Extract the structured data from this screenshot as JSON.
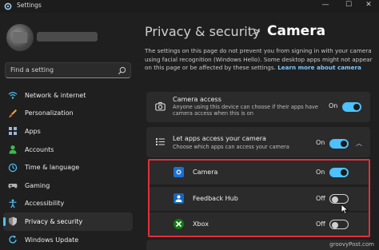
{
  "window": {
    "title": "Settings",
    "minimize": "—",
    "maximize": "☐",
    "close": "✕"
  },
  "sidebar": {
    "search_placeholder": "Find a setting",
    "items": [
      {
        "label": "Network & internet",
        "icon": "wifi-icon",
        "color": "#4cc2ff"
      },
      {
        "label": "Personalization",
        "icon": "brush-icon",
        "color": "#f0a04b"
      },
      {
        "label": "Apps",
        "icon": "apps-icon",
        "color": "#9bb7d4"
      },
      {
        "label": "Accounts",
        "icon": "person-icon",
        "color": "#3fb950"
      },
      {
        "label": "Time & language",
        "icon": "globe-clock-icon",
        "color": "#4cc2ff"
      },
      {
        "label": "Gaming",
        "icon": "gamepad-icon",
        "color": "#b0b0b0"
      },
      {
        "label": "Accessibility",
        "icon": "accessibility-icon",
        "color": "#4cc2ff"
      },
      {
        "label": "Privacy & security",
        "icon": "shield-icon",
        "color": "#8a8a8a"
      },
      {
        "label": "Windows Update",
        "icon": "update-icon",
        "color": "#4cc2ff"
      }
    ],
    "active_index": 7
  },
  "header": {
    "root": "Privacy & security",
    "separator": ">",
    "leaf": "Camera"
  },
  "description": {
    "text": "The settings on this page do not prevent you from signing in with your camera using facial recognition (Windows Hello). Some desktop apps might not appear on this page or be affected by these settings.",
    "link": "Learn more about camera"
  },
  "camera_access": {
    "title": "Camera access",
    "subtitle": "Anyone using this device can choose if their apps have camera access when this is on",
    "state": "On",
    "enabled": true
  },
  "apps_access": {
    "title": "Let apps access your camera",
    "subtitle": "Choose which apps can access your camera",
    "state": "On",
    "enabled": true,
    "expanded": true
  },
  "apps": [
    {
      "name": "Camera",
      "state": "On",
      "enabled": true,
      "icon": "camera-app-icon",
      "color": "#1f6fd1"
    },
    {
      "name": "Feedback Hub",
      "state": "Off",
      "enabled": false,
      "icon": "feedback-hub-icon",
      "color": "#1565c0"
    },
    {
      "name": "Xbox",
      "state": "Off",
      "enabled": false,
      "icon": "xbox-icon",
      "color": "#107c10"
    }
  ],
  "watermark": "groovyPost.com",
  "colors": {
    "accent": "#4cc2ff",
    "highlight_border": "#e0313b",
    "background": "#1f1f1f",
    "card": "#2b2b2b"
  }
}
